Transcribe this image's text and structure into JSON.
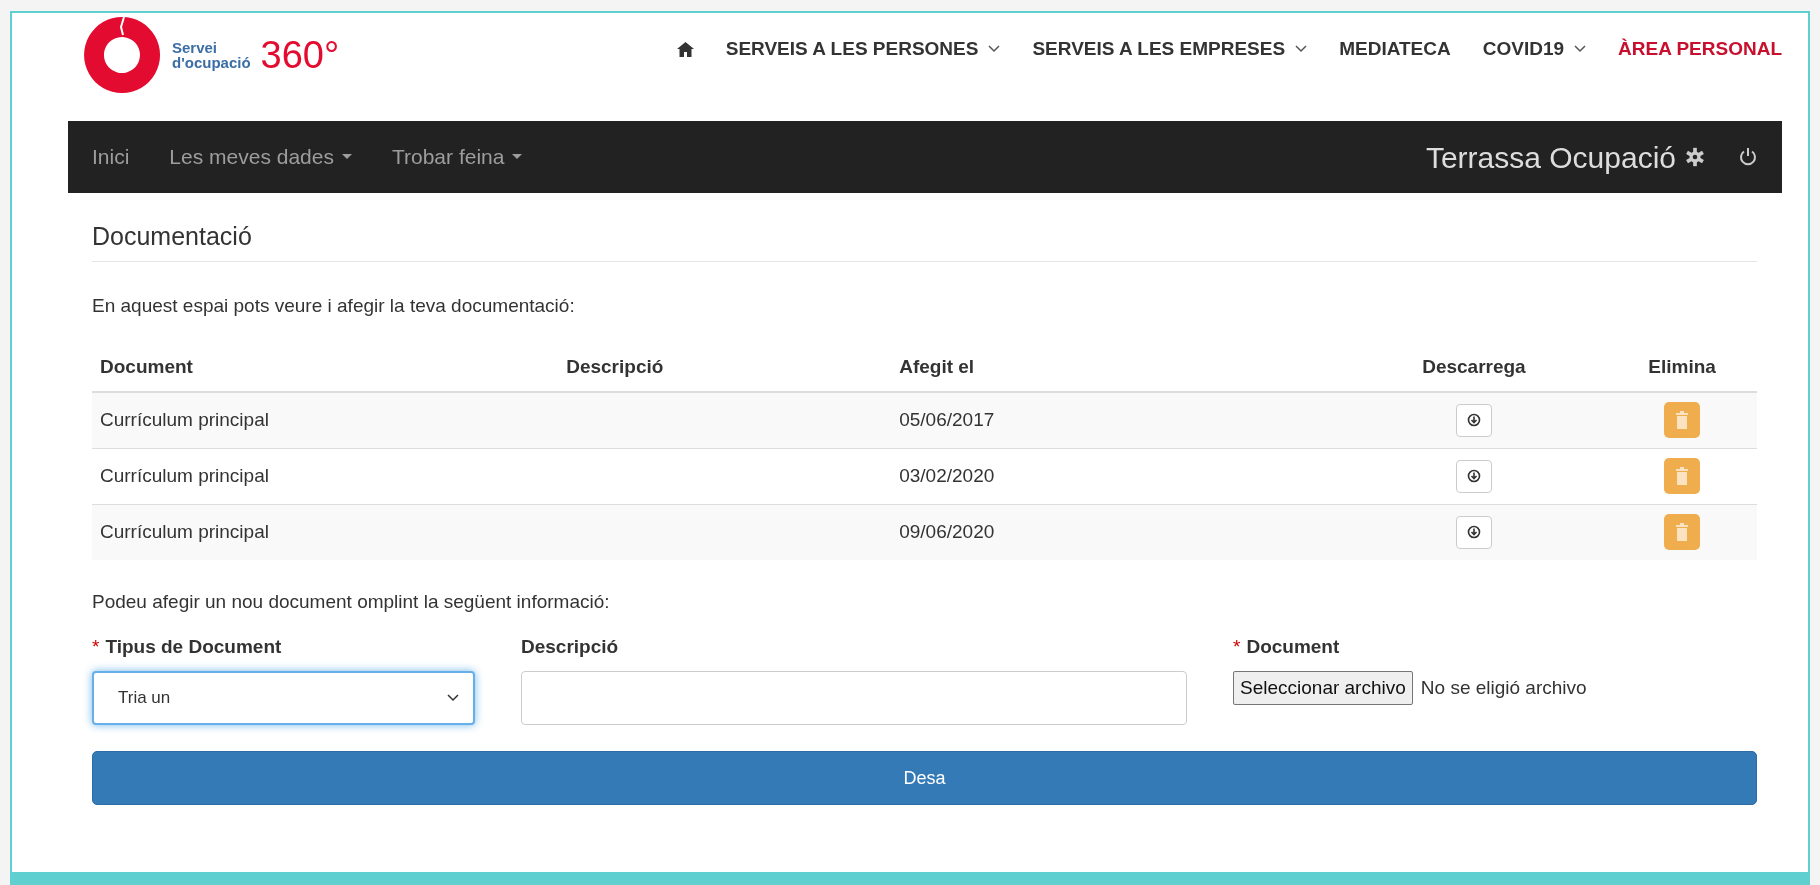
{
  "logo": {
    "line1": "Servei",
    "line2": "d'ocupació",
    "number": "360°"
  },
  "top_nav": {
    "items": [
      {
        "label": "SERVEIS A LES PERSONES",
        "dropdown": true,
        "highlighted": false
      },
      {
        "label": "SERVEIS A LES EMPRESES",
        "dropdown": true,
        "highlighted": false
      },
      {
        "label": "MEDIATECA",
        "dropdown": false,
        "highlighted": false
      },
      {
        "label": "COVID19",
        "dropdown": true,
        "highlighted": false
      },
      {
        "label": "ÀREA PERSONAL",
        "dropdown": false,
        "highlighted": true
      }
    ]
  },
  "navbar": {
    "items": [
      {
        "label": "Inici",
        "dropdown": false
      },
      {
        "label": "Les meves dades",
        "dropdown": true
      },
      {
        "label": "Trobar feina",
        "dropdown": true
      }
    ],
    "brand": "Terrassa Ocupació"
  },
  "page_title": "Documentació",
  "intro": "En aquest espai pots veure i afegir la teva documentació:",
  "table": {
    "columns": [
      "Document",
      "Descripció",
      "Afegit el",
      "Descarrega",
      "Elimina"
    ],
    "rows": [
      {
        "document": "Currículum principal",
        "date": "05/06/2017"
      },
      {
        "document": "Currículum principal",
        "date": "03/02/2020"
      },
      {
        "document": "Currículum principal",
        "date": "09/06/2020"
      }
    ]
  },
  "form_intro": "Podeu afegir un nou document omplint la següent informació:",
  "fields": [
    {
      "kind": "select",
      "label": "Tipus de Document",
      "required_mark": "*",
      "value": "Tria un",
      "focused": true
    },
    {
      "kind": "text",
      "label": "Descripció",
      "focused": false
    },
    {
      "kind": "file",
      "label": "Document",
      "required_mark": "*",
      "button": "Seleccionar archivo",
      "status": "No se eligió archivo"
    }
  ],
  "submit": "Desa"
}
